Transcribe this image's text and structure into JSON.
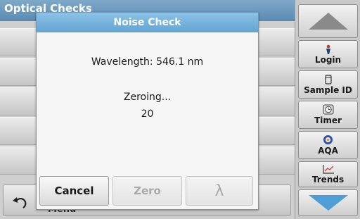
{
  "background": {
    "header_title": "Optical Checks",
    "menu_label": "Menu",
    "back_icon": "back-arrow-icon"
  },
  "dialog": {
    "title": "Noise Check",
    "wavelength_text": "Wavelength: 546.1 nm",
    "status_text": "Zeroing...",
    "count_text": "20",
    "buttons": {
      "cancel": "Cancel",
      "zero": "Zero",
      "lambda": "λ"
    }
  },
  "sidebar": {
    "scroll_up_icon": "triangle-up-icon",
    "scroll_down_icon": "triangle-down-icon",
    "items": [
      {
        "label": "Login",
        "icon": "person-icon"
      },
      {
        "label": "Sample ID",
        "icon": "sample-vial-icon"
      },
      {
        "label": "Timer",
        "icon": "timer-icon"
      },
      {
        "label": "AQA",
        "icon": "aqa-globe-icon"
      },
      {
        "label": "Trends",
        "icon": "trend-chart-icon"
      }
    ]
  },
  "colors": {
    "header_blue": "#5a8ab2",
    "dialog_title_blue": "#62a4d2",
    "scroll_arrow_blue": "#4f9fd6",
    "disabled_text": "#a9a9a9"
  }
}
